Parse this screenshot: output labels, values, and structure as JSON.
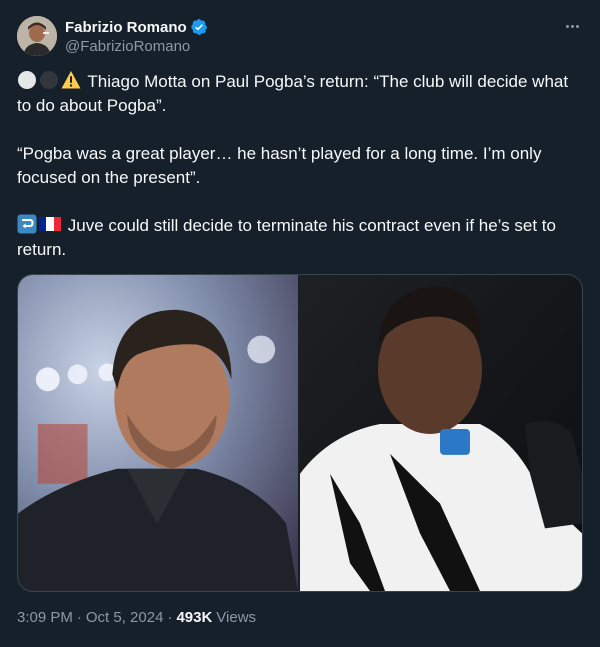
{
  "author": {
    "name": "Fabrizio Romano",
    "handle": "@FabrizioRomano",
    "verified_color": "#1d9bf0"
  },
  "tweet": {
    "line1": "Thiago Motta on Paul Pogba’s return: “The club will decide what to do about Pogba”.",
    "line2": "“Pogba was a great player… he hasn’t played for a long time. I’m only focused on the present”.",
    "line3": "Juve could still decide to terminate his contract even if he’s set to return.",
    "icons": [
      "white-circle-icon",
      "black-circle-icon",
      "warning-icon",
      "return-arrow-icon",
      "france-flag-icon"
    ]
  },
  "meta": {
    "time": "3:09 PM",
    "separator": "·",
    "date": "Oct 5, 2024",
    "views_count": "493K",
    "views_label": "Views"
  },
  "colors": {
    "background": "#15202b",
    "text": "#f7f9f9",
    "muted": "#8b98a5",
    "border": "#38444d",
    "accent": "#1d9bf0"
  }
}
